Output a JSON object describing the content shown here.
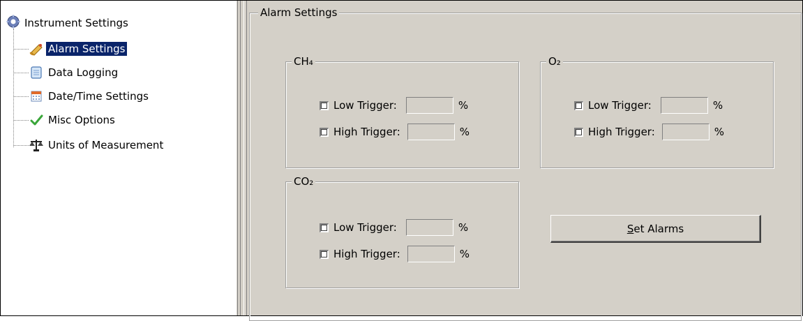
{
  "tree": {
    "root": {
      "label": "Instrument Settings",
      "icon": "gear-icon"
    },
    "items": [
      {
        "label": "Alarm Settings",
        "icon": "bell-icon",
        "selected": true
      },
      {
        "label": "Data Logging",
        "icon": "notebook-icon"
      },
      {
        "label": "Date/Time Settings",
        "icon": "calendar-icon"
      },
      {
        "label": "Misc Options",
        "icon": "checkmark-icon"
      },
      {
        "label": "Units of Measurement",
        "icon": "scale-icon"
      }
    ]
  },
  "alarm_settings": {
    "title": "Alarm Settings",
    "groups": {
      "ch4": {
        "title": "CH₄",
        "low": {
          "label": "Low Trigger:",
          "value": "",
          "unit": "%",
          "checked": false
        },
        "high": {
          "label": "High Trigger:",
          "value": "",
          "unit": "%",
          "checked": false
        }
      },
      "o2": {
        "title": "O₂",
        "low": {
          "label": "Low Trigger:",
          "value": "",
          "unit": "%",
          "checked": false
        },
        "high": {
          "label": "High Trigger:",
          "value": "",
          "unit": "%",
          "checked": false
        }
      },
      "co2": {
        "title": "CO₂",
        "low": {
          "label": "Low Trigger:",
          "value": "",
          "unit": "%",
          "checked": false
        },
        "high": {
          "label": "High Trigger:",
          "value": "",
          "unit": "%",
          "checked": false
        }
      }
    },
    "set_button": {
      "mnemonic": "S",
      "label_rest": "et Alarms"
    }
  },
  "colors": {
    "panel_bg": "#d4d0c8",
    "selection_bg": "#0a246a",
    "selection_text": "#ffffff",
    "tree_bg": "#ffffff"
  }
}
